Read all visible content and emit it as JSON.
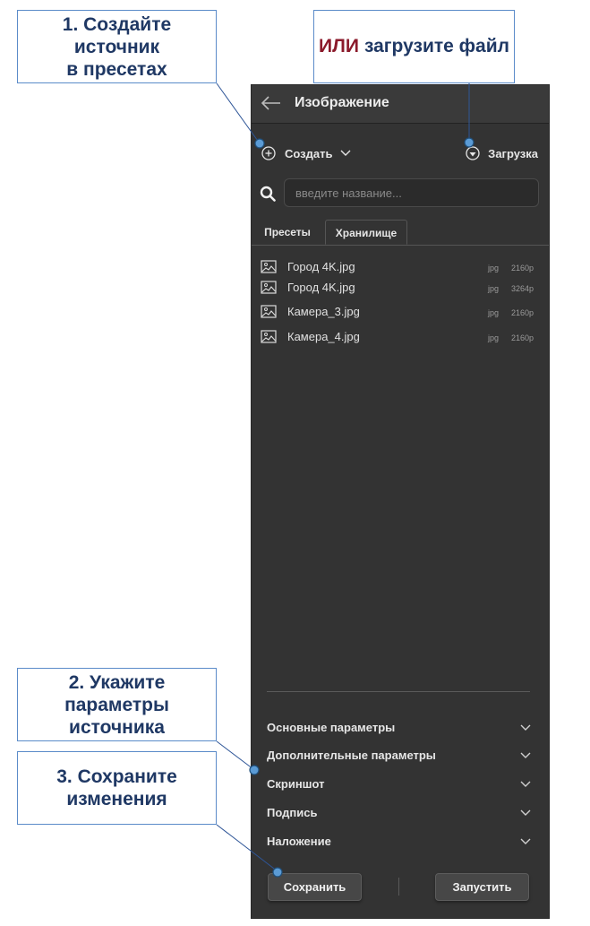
{
  "callouts": {
    "step1_line1": "1. Создайте источник",
    "step1_line2": "в пресетах",
    "or_accent": "ИЛИ",
    "or_text": "загрузите файл",
    "step2_line1": "2. Укажите параметры",
    "step2_line2": "источника",
    "step3_line1": "3. Сохраните",
    "step3_line2": "изменения"
  },
  "panel": {
    "title": "Изображение",
    "back_icon": "arrow-left-icon",
    "create_label": "Создать",
    "upload_label": "Загрузка",
    "search": {
      "placeholder": "введите название..."
    },
    "tabs": [
      {
        "label": "Пресеты",
        "active": false
      },
      {
        "label": "Хранилище",
        "active": true
      }
    ],
    "files": [
      {
        "name": "Город 4K.jpg",
        "ext": "jpg",
        "resolution": "2160p"
      },
      {
        "name": "Город 4K.jpg",
        "ext": "jpg",
        "resolution": "3264p"
      },
      {
        "name": "Камера_3.jpg",
        "ext": "jpg",
        "resolution": "2160p"
      },
      {
        "name": "Камера_4.jpg",
        "ext": "jpg",
        "resolution": "2160p"
      }
    ],
    "sections": [
      "Основные параметры",
      "Дополнительные параметры",
      "Скриншот",
      "Подпись",
      "Наложение"
    ],
    "save_label": "Сохранить",
    "run_label": "Запустить"
  },
  "colors": {
    "panel_bg": "#333333",
    "callout_text": "#1f3864",
    "callout_border": "#5b8bc9",
    "accent_red": "#8b1a2b",
    "marker_blue": "#5b9bd5"
  }
}
